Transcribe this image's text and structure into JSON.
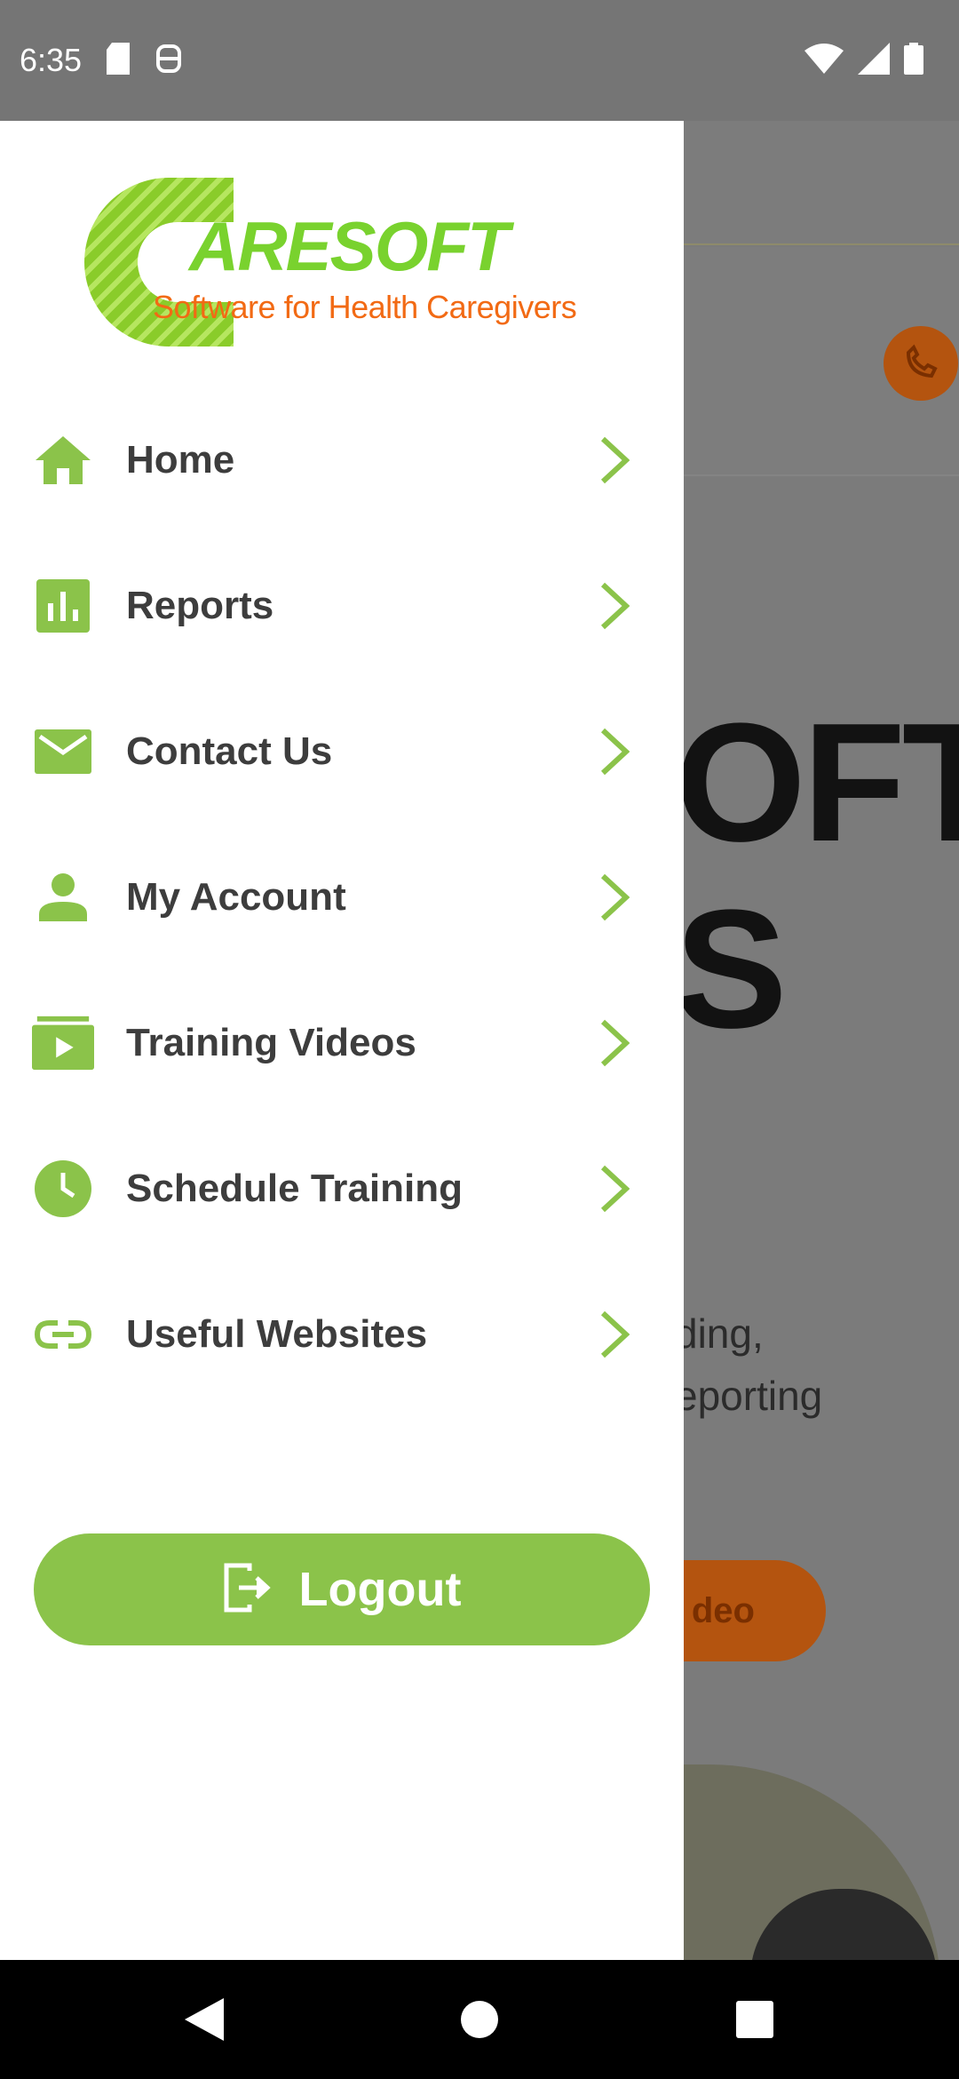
{
  "status_bar": {
    "time": "6:35"
  },
  "background_page": {
    "hero_title_line1": "OFT",
    "hero_title_line2": "S",
    "hero_sub_line1": "ding,",
    "hero_sub_line2": "eporting",
    "video_button_label": "deo"
  },
  "drawer": {
    "logo": {
      "name": "ARESOFT",
      "tagline": "Software for Health Caregivers"
    },
    "menu_items": [
      {
        "label": "Home",
        "icon": "home-icon"
      },
      {
        "label": "Reports",
        "icon": "bar-chart-icon"
      },
      {
        "label": "Contact Us",
        "icon": "mail-icon"
      },
      {
        "label": "My Account",
        "icon": "person-icon"
      },
      {
        "label": "Training Videos",
        "icon": "video-folder-icon"
      },
      {
        "label": "Schedule Training",
        "icon": "clock-icon"
      },
      {
        "label": "Useful Websites",
        "icon": "link-icon"
      }
    ],
    "logout_label": "Logout"
  },
  "colors": {
    "accent_green": "#8bc34a",
    "brand_orange": "#f26a14",
    "logo_green": "#79d22e"
  }
}
